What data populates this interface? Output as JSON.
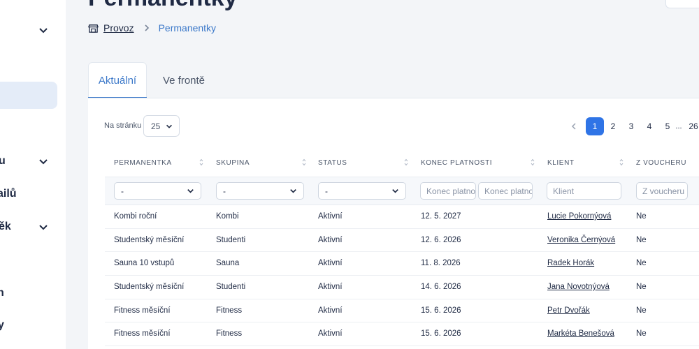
{
  "sidebar": {
    "items": [
      {
        "label": "u",
        "chevron": true
      },
      {
        "label": "ailů",
        "chevron": false
      },
      {
        "label": "ěk",
        "chevron": true
      },
      {
        "label": "n",
        "chevron": false
      },
      {
        "label": "y",
        "chevron": false
      }
    ]
  },
  "header": {
    "title": "Permanentky",
    "breadcrumb": {
      "home_icon": "store-icon",
      "home": "Provoz",
      "separator_icon": "chevron-right-icon",
      "current": "Permanentky"
    }
  },
  "tabs": [
    {
      "label": "Aktuální",
      "active": true
    },
    {
      "label": "Ve frontě",
      "active": false
    }
  ],
  "toolbar": {
    "per_page_label": "Na stránku",
    "per_page_value": "25",
    "pagination": {
      "prev_icon": "chevron-left-icon",
      "pages": [
        "1",
        "2",
        "3",
        "4",
        "5"
      ],
      "ellipsis": "...",
      "last": "26",
      "current": "1"
    }
  },
  "table": {
    "columns": [
      "PERMANENTKA",
      "SKUPINA",
      "STATUS",
      "KONEC PLATNOSTI",
      "KLIENT",
      "Z VOUCHERU"
    ],
    "filters": {
      "permanentka": "-",
      "skupina": "-",
      "status": "-",
      "konec_od_placeholder": "Konec platnosti od",
      "konec_do_placeholder": "Konec platnosti do",
      "klient_placeholder": "Klient",
      "voucher_placeholder": "Z voucheru"
    },
    "rows": [
      [
        "Kombi roční",
        "Kombi",
        "Aktivní",
        "12. 5. 2027",
        "Lucie Pokornýová",
        "Ne"
      ],
      [
        "Studentský měsíční",
        "Studenti",
        "Aktivní",
        "12. 6. 2026",
        "Veronika Černýová",
        "Ne"
      ],
      [
        "Sauna 10 vstupů",
        "Sauna",
        "Aktivní",
        "11. 8. 2026",
        "Radek Horák",
        "Ne"
      ],
      [
        "Studentský měsíční",
        "Studenti",
        "Aktivní",
        "14. 6. 2026",
        "Jana Novotnýová",
        "Ne"
      ],
      [
        "Fitness měsíční",
        "Fitness",
        "Aktivní",
        "15. 6. 2026",
        "Petr Dvořák",
        "Ne"
      ],
      [
        "Fitness měsíční",
        "Fitness",
        "Aktivní",
        "15. 6. 2026",
        "Markéta Benešová",
        "Ne"
      ]
    ]
  },
  "colors": {
    "accent": "#2f74e6",
    "link": "#3b78c9",
    "text": "#1f2a44",
    "sidebar_active": "#e4ecf8"
  }
}
